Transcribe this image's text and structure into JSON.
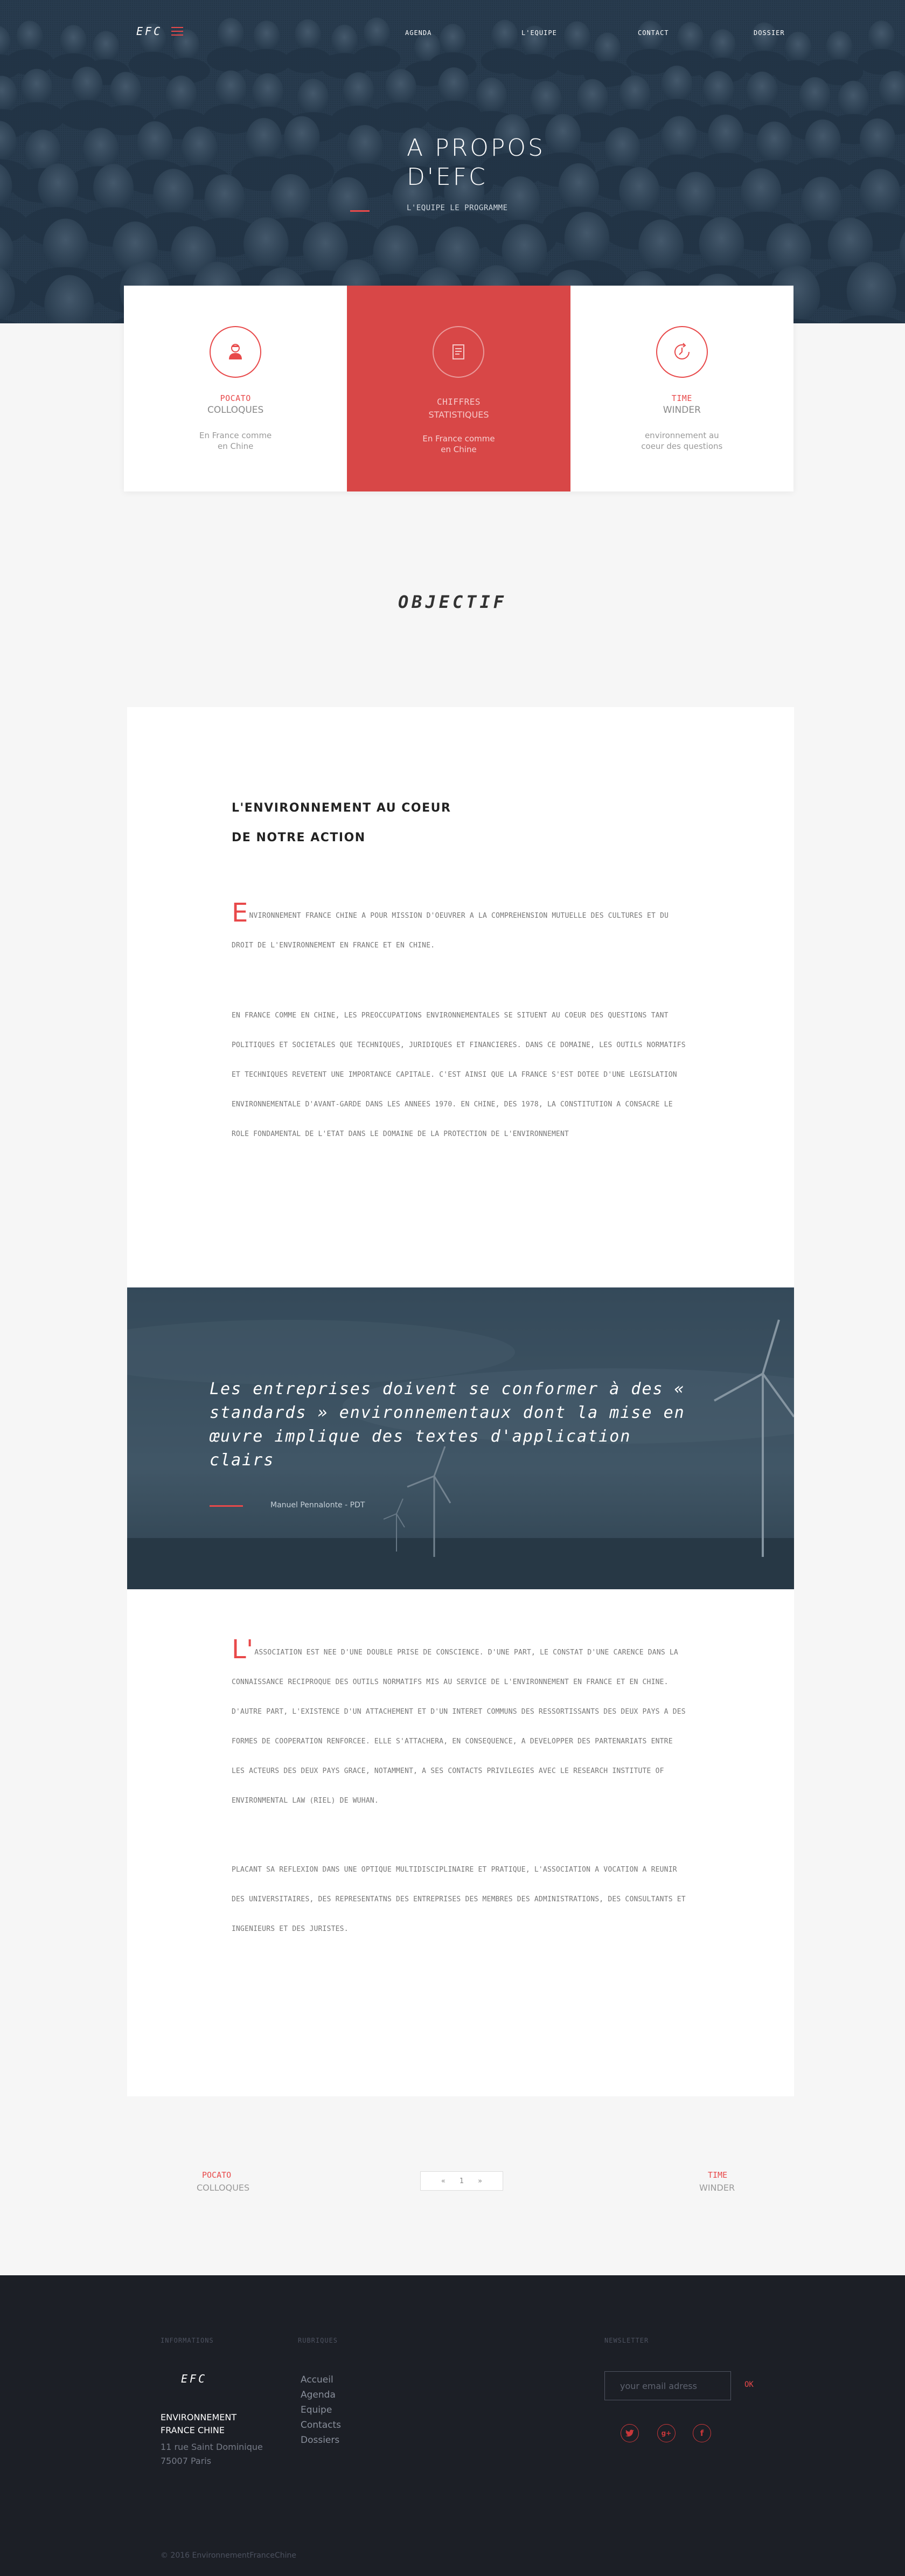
{
  "header": {
    "logo": "EFC",
    "nav": [
      "AGENDA",
      "L'EQUIPE",
      "CONTACT",
      "DOSSIER"
    ]
  },
  "hero": {
    "title_line1": "A PROPOS",
    "title_line2": "D'EFC",
    "subtitle": "L'EQUIPE LE PROGRAMME"
  },
  "cards": [
    {
      "title": "POCATO",
      "subtitle": "COLLOQUES",
      "desc_line1": "En France comme",
      "desc_line2": "en Chine",
      "icon": "person-icon"
    },
    {
      "title": "CHIFFRES",
      "subtitle": "STATISTIQUES",
      "desc_line1": "En France comme",
      "desc_line2": "en Chine",
      "icon": "document-icon"
    },
    {
      "title": "TIME",
      "subtitle": "WINDER",
      "desc_line1": "environnement au",
      "desc_line2": "coeur des questions",
      "icon": "clock-icon"
    }
  ],
  "objectif": "OBJECTIF",
  "article": {
    "heading_line1": "L'ENVIRONNEMENT AU COEUR",
    "heading_line2": "DE NOTRE ACTION",
    "p1_dropcap": "E",
    "p1_rest": "NVIRONNEMENT FRANCE CHINE A POUR MISSION D'OEUVRER A LA COMPREHENSION  MUTUELLE DES CULTURES ET DU DROIT DE L'ENVIRONNEMENT EN FRANCE ET EN CHINE.",
    "p2": "EN FRANCE COMME EN CHINE, LES PREOCCUPATIONS ENVIRONNEMENTALES SE SITUENT AU COEUR DES QUESTIONS TANT POLITIQUES ET SOCIETALES QUE TECHNIQUES, JURIDIQUES ET FINANCIERES. DANS CE DOMAINE, LES OUTILS NORMATIFS ET TECHNIQUES REVETENT UNE IMPORTANCE CAPITALE. C'EST AINSI QUE LA FRANCE S'EST DOTEE D'UNE LEGISLATION ENVIRONNEMENTALE D'AVANT-GARDE DANS LES ANNEES 1970. EN CHINE, DES 1978, LA CONSTITUTION A CONSACRE LE ROLE FONDAMENTAL DE L'ETAT DANS LE DOMAINE DE LA PROTECTION DE L'ENVIRONNEMENT",
    "quote": "Les entreprises doivent se conformer à des « standards » environnementaux dont la mise en œuvre implique des textes d'application clairs",
    "quote_author": "Manuel Pennalonte - PDT",
    "p3_dropcap": "L'",
    "p3_rest": "ASSOCIATION EST NEE D'UNE DOUBLE PRISE DE CONSCIENCE. D'UNE PART, LE CONSTAT D'UNE CARENCE DANS LA CONNAISSANCE RECIPROQUE DES OUTILS NORMATIFS MIS AU SERVICE DE L'ENVIRONNEMENT EN FRANCE ET EN CHINE. D'AUTRE PART, L'EXISTENCE D'UN ATTACHEMENT ET D'UN INTERET COMMUNS DES RESSORTISSANTS DES DEUX PAYS A DES FORMES DE COOPERATION RENFORCEE. ELLE S'ATTACHERA, EN CONSEQUENCE, A DEVELOPPER DES PARTENARIATS ENTRE LES ACTEURS DES DEUX PAYS GRACE, NOTAMMENT, A SES CONTACTS PRIVILEGIES AVEC LE RESEARCH INSTITUTE OF ENVIRONMENTAL LAW (RIEL) DE WUHAN.",
    "p4": "PLACANT SA REFLEXION DANS UNE OPTIQUE MULTIDISCIPLINAIRE ET PRATIQUE, L'ASSOCIATION A VOCATION A REUNIR DES UNIVERSITAIRES, DES REPRESENTATNS DES ENTREPRISES DES MEMBRES DES ADMINISTRATIONS, DES CONSULTANTS ET INGENIEURS ET DES JURISTES."
  },
  "pager": {
    "prev_title": "POCATO",
    "prev_sub": "COLLOQUES",
    "prev_arrow": "«",
    "page": "1",
    "next_arrow": "»",
    "next_title": "TIME",
    "next_sub": "WINDER"
  },
  "footer": {
    "col1_head": "INFORMATIONS",
    "col2_head": "RUBRIQUES",
    "col3_head": "NEWSLETTER",
    "logo": "EFC",
    "org_line1": "ENVIRONNEMENT",
    "org_line2": "FRANCE CHINE",
    "addr_line1": "11 rue Saint Dominique",
    "addr_line2": "75007 Paris",
    "links": [
      "Accueil",
      "Agenda",
      "Equipe",
      "Contacts",
      "Dossiers"
    ],
    "newsletter_placeholder": "your email adress",
    "ok": "OK",
    "social": [
      "twitter-icon",
      "google-plus-icon",
      "facebook-icon"
    ],
    "copyright": "© 2016 EnvironnementFranceChine"
  },
  "colors": {
    "accent": "#e8494a",
    "hero": "#2f4356",
    "footer": "#1c1f26"
  }
}
